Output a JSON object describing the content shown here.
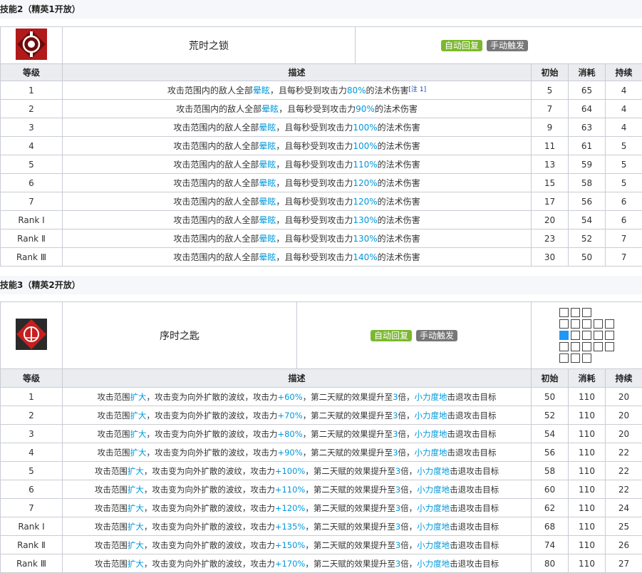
{
  "skill2": {
    "section_title": "技能2（精英1开放）",
    "name": "荒时之锁",
    "tags": [
      "自动回复",
      "手动触发"
    ],
    "headers": [
      "等级",
      "描述",
      "初始",
      "消耗",
      "持续"
    ],
    "rows": [
      {
        "level": "1",
        "pre": "攻击范围内的敌人全部",
        "hl1": "晕眩",
        "mid": "，且每秒受到攻击力",
        "hl2": "80%",
        "post": "的法术伤害",
        "note": "[注 1]",
        "init": "5",
        "cost": "65",
        "dur": "4"
      },
      {
        "level": "2",
        "pre": "攻击范围内的敌人全部",
        "hl1": "晕眩",
        "mid": "，且每秒受到攻击力",
        "hl2": "90%",
        "post": "的法术伤害",
        "note": "",
        "init": "7",
        "cost": "64",
        "dur": "4"
      },
      {
        "level": "3",
        "pre": "攻击范围内的敌人全部",
        "hl1": "晕眩",
        "mid": "，且每秒受到攻击力",
        "hl2": "100%",
        "post": "的法术伤害",
        "note": "",
        "init": "9",
        "cost": "63",
        "dur": "4"
      },
      {
        "level": "4",
        "pre": "攻击范围内的敌人全部",
        "hl1": "晕眩",
        "mid": "，且每秒受到攻击力",
        "hl2": "100%",
        "post": "的法术伤害",
        "note": "",
        "init": "11",
        "cost": "61",
        "dur": "5"
      },
      {
        "level": "5",
        "pre": "攻击范围内的敌人全部",
        "hl1": "晕眩",
        "mid": "，且每秒受到攻击力",
        "hl2": "110%",
        "post": "的法术伤害",
        "note": "",
        "init": "13",
        "cost": "59",
        "dur": "5"
      },
      {
        "level": "6",
        "pre": "攻击范围内的敌人全部",
        "hl1": "晕眩",
        "mid": "，且每秒受到攻击力",
        "hl2": "120%",
        "post": "的法术伤害",
        "note": "",
        "init": "15",
        "cost": "58",
        "dur": "5"
      },
      {
        "level": "7",
        "pre": "攻击范围内的敌人全部",
        "hl1": "晕眩",
        "mid": "，且每秒受到攻击力",
        "hl2": "120%",
        "post": "的法术伤害",
        "note": "",
        "init": "17",
        "cost": "56",
        "dur": "6"
      },
      {
        "level": "Rank Ⅰ",
        "pre": "攻击范围内的敌人全部",
        "hl1": "晕眩",
        "mid": "，且每秒受到攻击力",
        "hl2": "130%",
        "post": "的法术伤害",
        "note": "",
        "init": "20",
        "cost": "54",
        "dur": "6"
      },
      {
        "level": "Rank Ⅱ",
        "pre": "攻击范围内的敌人全部",
        "hl1": "晕眩",
        "mid": "，且每秒受到攻击力",
        "hl2": "130%",
        "post": "的法术伤害",
        "note": "",
        "init": "23",
        "cost": "52",
        "dur": "7"
      },
      {
        "level": "Rank Ⅲ",
        "pre": "攻击范围内的敌人全部",
        "hl1": "晕眩",
        "mid": "，且每秒受到攻击力",
        "hl2": "140%",
        "post": "的法术伤害",
        "note": "",
        "init": "30",
        "cost": "50",
        "dur": "7"
      }
    ]
  },
  "skill3": {
    "section_title": "技能3（精英2开放）",
    "name": "序时之匙",
    "tags": [
      "自动回复",
      "手动触发"
    ],
    "headers": [
      "等级",
      "描述",
      "初始",
      "消耗",
      "持续"
    ],
    "rows": [
      {
        "level": "1",
        "a": "攻击范围",
        "b": "扩大",
        "c": "，攻击变为向外扩散的波纹，攻击力",
        "d": "+60%",
        "e": "，第二天赋的效果提升至",
        "f": "3",
        "g": "倍，",
        "h": "小力度地",
        "i": "击退攻击目标",
        "init": "50",
        "cost": "110",
        "dur": "20"
      },
      {
        "level": "2",
        "a": "攻击范围",
        "b": "扩大",
        "c": "，攻击变为向外扩散的波纹，攻击力",
        "d": "+70%",
        "e": "，第二天赋的效果提升至",
        "f": "3",
        "g": "倍，",
        "h": "小力度地",
        "i": "击退攻击目标",
        "init": "52",
        "cost": "110",
        "dur": "20"
      },
      {
        "level": "3",
        "a": "攻击范围",
        "b": "扩大",
        "c": "，攻击变为向外扩散的波纹，攻击力",
        "d": "+80%",
        "e": "，第二天赋的效果提升至",
        "f": "3",
        "g": "倍，",
        "h": "小力度地",
        "i": "击退攻击目标",
        "init": "54",
        "cost": "110",
        "dur": "20"
      },
      {
        "level": "4",
        "a": "攻击范围",
        "b": "扩大",
        "c": "，攻击变为向外扩散的波纹，攻击力",
        "d": "+90%",
        "e": "，第二天赋的效果提升至",
        "f": "3",
        "g": "倍，",
        "h": "小力度地",
        "i": "击退攻击目标",
        "init": "56",
        "cost": "110",
        "dur": "22"
      },
      {
        "level": "5",
        "a": "攻击范围",
        "b": "扩大",
        "c": "，攻击变为向外扩散的波纹，攻击力",
        "d": "+100%",
        "e": "，第二天赋的效果提升至",
        "f": "3",
        "g": "倍，",
        "h": "小力度地",
        "i": "击退攻击目标",
        "init": "58",
        "cost": "110",
        "dur": "22"
      },
      {
        "level": "6",
        "a": "攻击范围",
        "b": "扩大",
        "c": "，攻击变为向外扩散的波纹，攻击力",
        "d": "+110%",
        "e": "，第二天赋的效果提升至",
        "f": "3",
        "g": "倍，",
        "h": "小力度地",
        "i": "击退攻击目标",
        "init": "60",
        "cost": "110",
        "dur": "22"
      },
      {
        "level": "7",
        "a": "攻击范围",
        "b": "扩大",
        "c": "，攻击变为向外扩散的波纹，攻击力",
        "d": "+120%",
        "e": "，第二天赋的效果提升至",
        "f": "3",
        "g": "倍，",
        "h": "小力度地",
        "i": "击退攻击目标",
        "init": "62",
        "cost": "110",
        "dur": "24"
      },
      {
        "level": "Rank Ⅰ",
        "a": "攻击范围",
        "b": "扩大",
        "c": "，攻击变为向外扩散的波纹，攻击力",
        "d": "+135%",
        "e": "，第二天赋的效果提升至",
        "f": "3",
        "g": "倍，",
        "h": "小力度地",
        "i": "击退攻击目标",
        "init": "68",
        "cost": "110",
        "dur": "25"
      },
      {
        "level": "Rank Ⅱ",
        "a": "攻击范围",
        "b": "扩大",
        "c": "，攻击变为向外扩散的波纹，攻击力",
        "d": "+150%",
        "e": "，第二天赋的效果提升至",
        "f": "3",
        "g": "倍，",
        "h": "小力度地",
        "i": "击退攻击目标",
        "init": "74",
        "cost": "110",
        "dur": "26"
      },
      {
        "level": "Rank Ⅲ",
        "a": "攻击范围",
        "b": "扩大",
        "c": "，攻击变为向外扩散的波纹，攻击力",
        "d": "+170%",
        "e": "，第二天赋的效果提升至",
        "f": "3",
        "g": "倍，",
        "h": "小力度地",
        "i": "击退攻击目标",
        "init": "80",
        "cost": "110",
        "dur": "27"
      }
    ]
  },
  "colors": {
    "highlight": "#0098dc",
    "tag_green": "#7cb82f",
    "tag_gray": "#777777",
    "range_self": "#2196f3"
  },
  "icons": {
    "skill2": "lock-skill-icon",
    "skill3": "key-skill-icon"
  }
}
